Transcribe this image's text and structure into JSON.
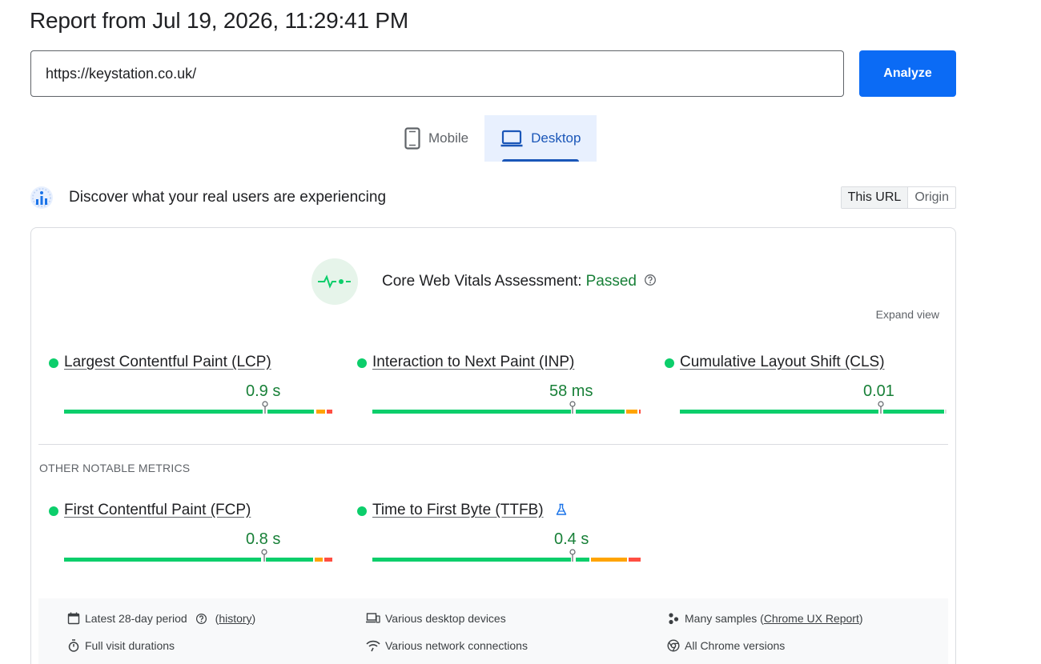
{
  "header": {
    "title": "Report from Jul 19, 2026, 11:29:41 PM"
  },
  "url_field": {
    "value": "https://keystation.co.uk/"
  },
  "analyze_button": {
    "label": "Analyze"
  },
  "device_tabs": [
    {
      "label": "Mobile",
      "icon": "smartphone-icon",
      "active": false
    },
    {
      "label": "Desktop",
      "icon": "laptop-icon",
      "active": true
    }
  ],
  "field_data": {
    "title": "Discover what your real users are experiencing",
    "scope_toggle": {
      "this_url": "This URL",
      "origin": "Origin",
      "selected": "This URL"
    }
  },
  "assessment": {
    "label": "Core Web Vitals Assessment:",
    "status": "Passed",
    "expand_label": "Expand view"
  },
  "core_metrics": [
    {
      "name": "Largest Contentful Paint (LCP)",
      "value": "0.9 s"
    },
    {
      "name": "Interaction to Next Paint (INP)",
      "value": "58 ms"
    },
    {
      "name": "Cumulative Layout Shift (CLS)",
      "value": "0.01"
    }
  ],
  "other_metrics_title": "OTHER NOTABLE METRICS",
  "other_metrics": [
    {
      "name": "First Contentful Paint (FCP)",
      "value": "0.8 s"
    },
    {
      "name": "Time to First Byte (TTFB)",
      "value": "0.4 s",
      "experimental": true
    }
  ],
  "footer": {
    "period": "Latest 28-day period",
    "history_link": "history",
    "devices": "Various desktop devices",
    "samples_prefix": "Many samples (",
    "samples_link": "Chrome UX Report",
    "samples_suffix": ")",
    "durations": "Full visit durations",
    "network": "Various network connections",
    "chrome": "All Chrome versions"
  },
  "colors": {
    "good": "#0cce6b",
    "average": "#ffa400",
    "poor": "#ff4e42",
    "accent": "#0b6bf5",
    "pass_text": "#188038"
  }
}
